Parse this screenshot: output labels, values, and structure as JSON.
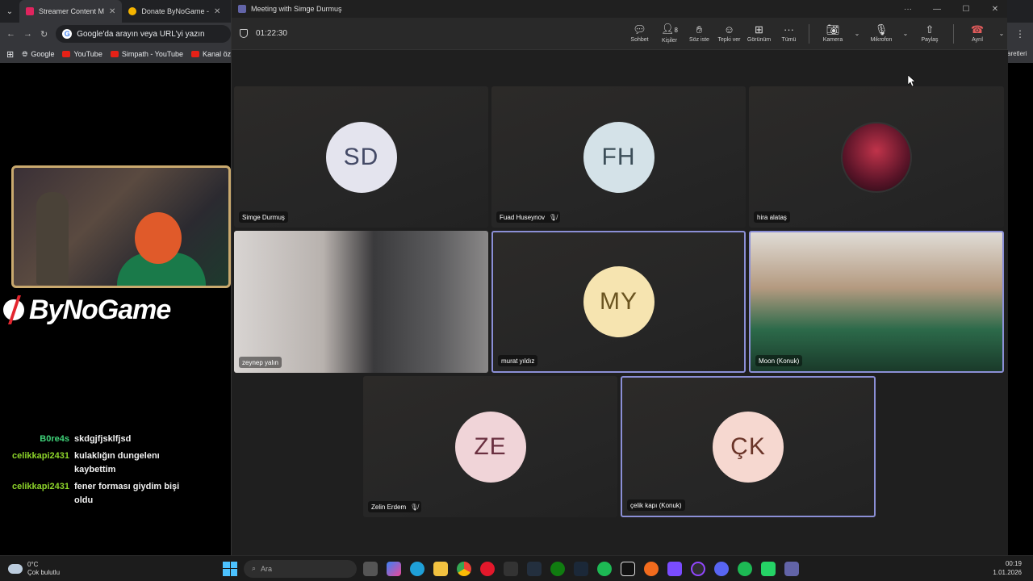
{
  "browser": {
    "tabs": [
      {
        "label": "Streamer Content M",
        "color": "#e0245e"
      },
      {
        "label": "Donate ByNoGame -",
        "color": "#f5b400"
      }
    ],
    "omnibox_placeholder": "Google'da arayın veya URL'yi yazın",
    "bookmarks": [
      "Google",
      "YouTube",
      "Simpath - YouTube",
      "Kanal öz"
    ],
    "right_clip": "aretleri"
  },
  "overlay": {
    "brand": "ByNoGame",
    "chat": [
      {
        "user": "B0re4s",
        "text": "skdgjfjsklfjsd",
        "color": "#3fd47a"
      },
      {
        "user": "celikkapi2431",
        "text": "kulaklığın dungelenı kaybettim",
        "color": "#8dd42a"
      },
      {
        "user": "celikkapi2431",
        "text": "fener forması giydim bişi oldu",
        "color": "#8dd42a"
      }
    ]
  },
  "teams": {
    "window_title": "Meeting with Simge Durmuş",
    "timer": "01:22:30",
    "toolbar": {
      "chat": "Sohbet",
      "people": "Kişiler",
      "people_count": "8",
      "raise": "Söz iste",
      "react": "Tepki ver",
      "view": "Görünüm",
      "more": "Tümü",
      "camera": "Kamera",
      "mic": "Mikrofon",
      "share": "Paylaş",
      "leave": "Ayrıl"
    },
    "participants": [
      {
        "initials": "SD",
        "name": "Simge Durmuş",
        "muted": false,
        "speaking": false,
        "bg": "#e4e4ee",
        "fg": "#444a66"
      },
      {
        "initials": "FH",
        "name": "Fuad Huseynov",
        "muted": true,
        "speaking": false,
        "bg": "#d4e2e8",
        "fg": "#3c4e58"
      },
      {
        "initials": "",
        "name": "hira alataş",
        "muted": false,
        "speaking": false
      },
      {
        "initials": "",
        "name": "zeynep yalın",
        "muted": false,
        "speaking": false
      },
      {
        "initials": "MY",
        "name": "murat yıldız",
        "muted": false,
        "speaking": true,
        "bg": "#f6e4b0",
        "fg": "#6a5420"
      },
      {
        "initials": "",
        "name": "Moon (Konuk)",
        "muted": false,
        "speaking": true
      },
      {
        "initials": "ZE",
        "name": "Zelin Erdem",
        "muted": true,
        "speaking": false,
        "bg": "#f0d4d8",
        "fg": "#6a3040"
      },
      {
        "initials": "ÇK",
        "name": "çelik kapı (Konuk)",
        "muted": false,
        "speaking": true,
        "bg": "#f6d8d0",
        "fg": "#6a3428"
      }
    ]
  },
  "taskbar": {
    "weather_temp": "0°C",
    "weather_desc": "Çok bulutlu",
    "search_placeholder": "Ara",
    "time": "00:19",
    "date": "1.01.2026"
  }
}
